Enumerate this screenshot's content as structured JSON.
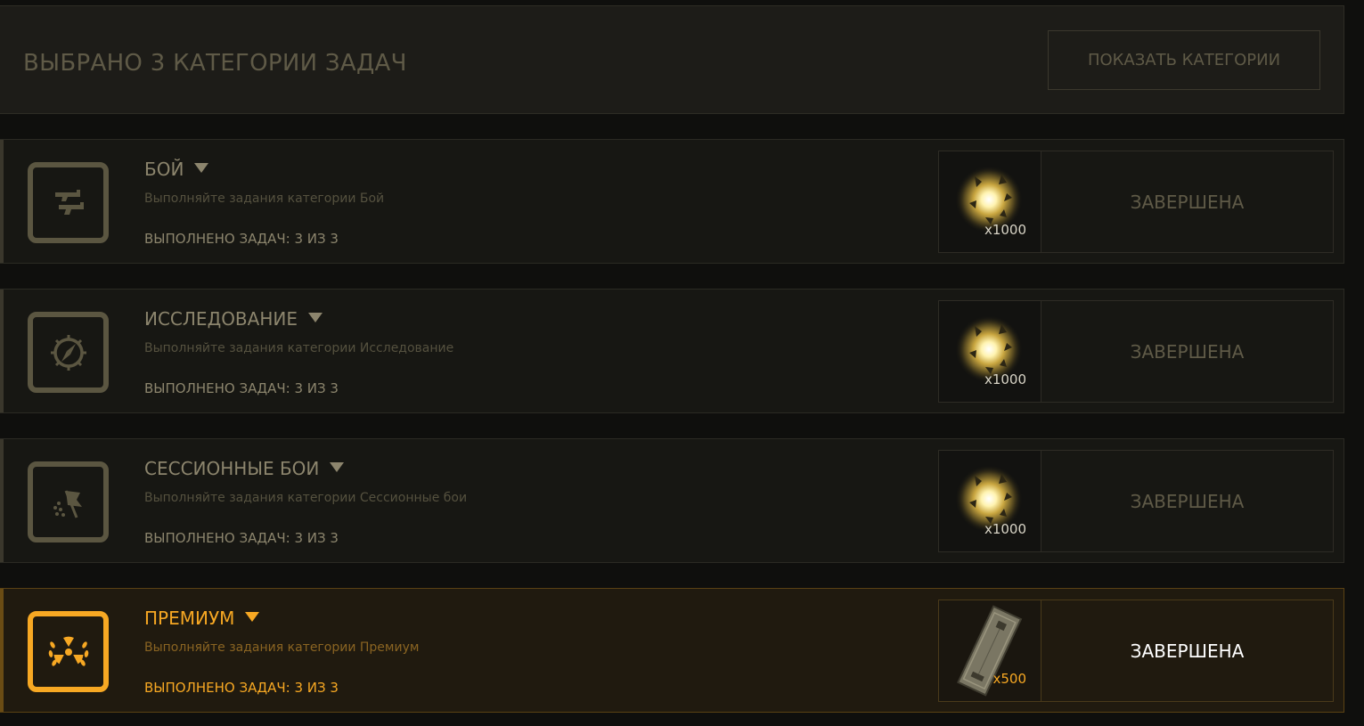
{
  "header": {
    "title": "ВЫБРАНО 3 КАТЕГОРИИ ЗАДАЧ",
    "button_label": "ПОКАЗАТЬ КАТЕГОРИИ"
  },
  "categories": [
    {
      "name": "БОЙ",
      "description": "Выполняйте задания категории Бой",
      "progress": "ВЫПОЛНЕНО ЗАДАЧ: 3 ИЗ 3",
      "icon": "pistols-icon",
      "reward_icon": "energy-orb-icon",
      "reward_count": "x1000",
      "status": "ЗАВЕРШЕНА"
    },
    {
      "name": "ИССЛЕДОВАНИЕ",
      "description": "Выполняйте задания категории Исследование",
      "progress": "ВЫПОЛНЕНО ЗАДАЧ: 3 ИЗ 3",
      "icon": "compass-icon",
      "reward_icon": "energy-orb-icon",
      "reward_count": "x1000",
      "status": "ЗАВЕРШЕНА"
    },
    {
      "name": "СЕССИОННЫЕ БОИ",
      "description": "Выполняйте задания категории Сессионные бои",
      "progress": "ВЫПОЛНЕНО ЗАДАЧ: 3 ИЗ 3",
      "icon": "flag-icon",
      "reward_icon": "energy-orb-icon",
      "reward_count": "x1000",
      "status": "ЗАВЕРШЕНА"
    },
    {
      "name": "ПРЕМИУМ",
      "description": "Выполняйте задания категории Премиум",
      "progress": "ВЫПОЛНЕНО ЗАДАЧ: 3 ИЗ 3",
      "icon": "radiation-laurel-icon",
      "reward_icon": "container-icon",
      "reward_count": "x500",
      "status": "ЗАВЕРШЕНА"
    }
  ],
  "colors": {
    "accent": "#f7a823",
    "muted": "#5f5a47",
    "text": "#8c856d",
    "background": "#0f0f0d"
  }
}
